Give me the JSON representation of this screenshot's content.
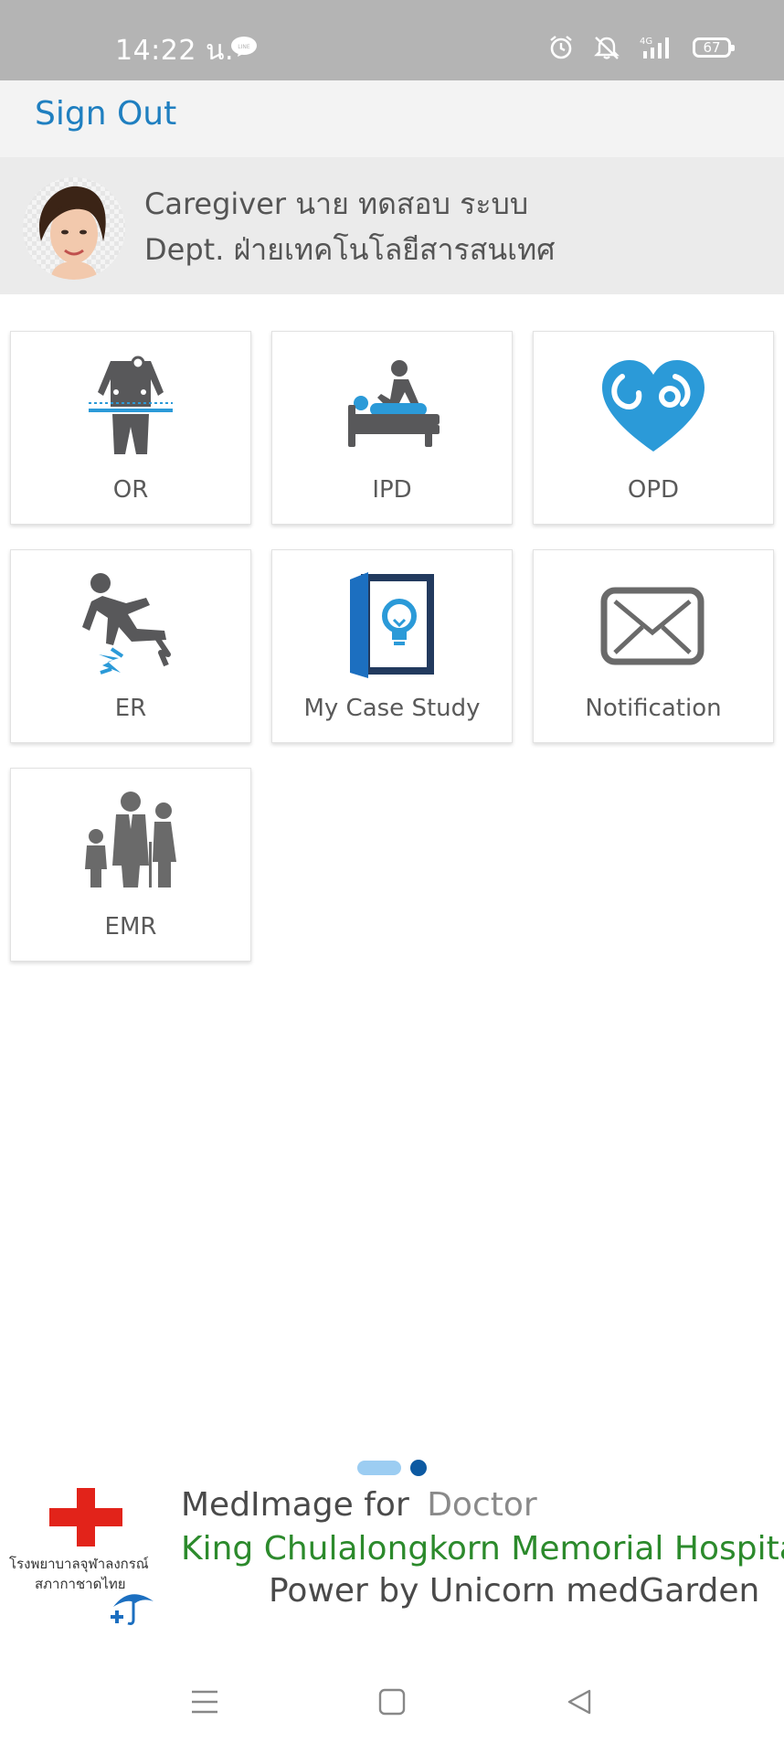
{
  "status_bar": {
    "time": "14:22 น.",
    "battery": "67",
    "network": "4G"
  },
  "header": {
    "sign_out": "Sign Out"
  },
  "profile": {
    "role_line": "Caregiver นาย ทดสอบ ระบบ",
    "dept_line": "Dept. ฝ่ายเทคโนโลยีสารสนเทศ"
  },
  "menu": {
    "items": [
      {
        "label": "OR",
        "icon": "surgery-icon"
      },
      {
        "label": "IPD",
        "icon": "inpatient-bed-icon"
      },
      {
        "label": "OPD",
        "icon": "heart-stethoscope-icon"
      },
      {
        "label": "ER",
        "icon": "emergency-fall-icon"
      },
      {
        "label": "My Case Study",
        "icon": "case-study-book-icon"
      },
      {
        "label": "Notification",
        "icon": "envelope-icon"
      },
      {
        "label": "EMR",
        "icon": "family-icon"
      }
    ]
  },
  "footer": {
    "app_prefix": "MedImage for",
    "app_role": "Doctor",
    "hospital": "King Chulalongkorn Memorial Hospital",
    "powered_by": "Power by Unicorn medGarden",
    "logo_text_1": "โรงพยาบาลจุฬาลงกรณ์",
    "logo_text_2": "สภากาชาดไทย"
  },
  "colors": {
    "accent_blue": "#1f7fc0",
    "icon_gray": "#58585a",
    "icon_blue": "#2b9ad8",
    "hospital_green": "#2c8a2c",
    "red_cross": "#e2231a"
  }
}
